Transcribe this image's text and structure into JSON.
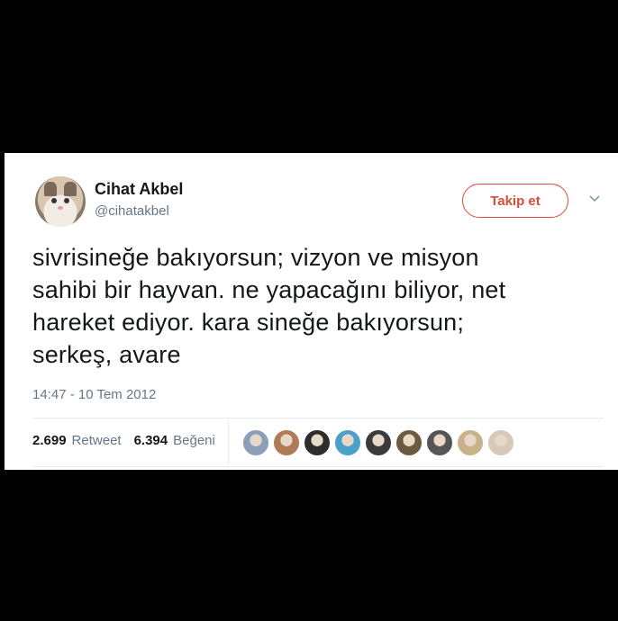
{
  "user": {
    "name": "Cihat Akbel",
    "handle": "@cihatakbel"
  },
  "follow_label": "Takip et",
  "tweet": {
    "lines": [
      "sivrisineğe bakıyorsun; vizyon ve misyon",
      "sahibi bir hayvan. ne yapacağını biliyor, net",
      "hareket ediyor. kara sineğe bakıyorsun;",
      "serkeş, avare"
    ],
    "timestamp": "14:47 - 10 Tem 2012"
  },
  "stats": {
    "retweet_count": "2.699",
    "retweet_label": "Retweet",
    "like_count": "6.394",
    "like_label": "Beğeni"
  },
  "colors": {
    "accent": "#d84a3a",
    "secondary_text": "#657786",
    "likers": [
      "#8aa0b8",
      "#b07a56",
      "#2d2d2d",
      "#4aa0c8",
      "#3a3a3a",
      "#6b5a40",
      "#555555",
      "#c9b28a",
      "#d8c8b8"
    ]
  }
}
